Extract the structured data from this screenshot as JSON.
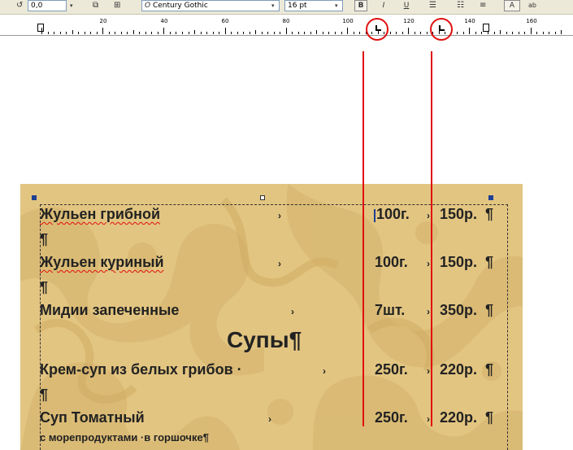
{
  "toolbar": {
    "rotation_value": "0,0",
    "font_name": "Century Gothic",
    "font_size": "16 pt",
    "bold_label": "B",
    "italic_label": "I",
    "underline_label": "U",
    "style_label": "A",
    "abc_label": "ab"
  },
  "ruler": {
    "labels": [
      "20",
      "40",
      "60",
      "80",
      "100",
      "120",
      "140",
      "160"
    ]
  },
  "menu": {
    "items": [
      {
        "name": "Жульен грибной",
        "arrow1": "›",
        "qty": "100г.",
        "arrow2": "›",
        "price": "150р.",
        "pil": "¶"
      },
      {
        "name": "Жульен куриный",
        "arrow1": "›",
        "qty": "100г.",
        "arrow2": "›",
        "price": "150р.",
        "pil": "¶"
      },
      {
        "name": "Мидии запеченные",
        "arrow1": "›",
        "qty": "7шт.",
        "arrow2": "›",
        "price": "350р.",
        "pil": "¶"
      },
      {
        "name": "Крем-суп из белых грибов ·",
        "arrow1": "›",
        "qty": "250г.",
        "arrow2": "›",
        "price": "220р.",
        "pil": "¶"
      },
      {
        "name": "Суп Томатный",
        "arrow1": "›",
        "qty": "250г.",
        "arrow2": "›",
        "price": "220р.",
        "pil": "¶"
      }
    ],
    "empty_pil": "¶",
    "heading": "Супы¶",
    "subtitle": "с морепродуктами ·в горшочке¶"
  },
  "colors": {
    "annotation": "#e01010",
    "background": "#e2c581",
    "text": "#222222",
    "handle": "#1f3f94"
  }
}
